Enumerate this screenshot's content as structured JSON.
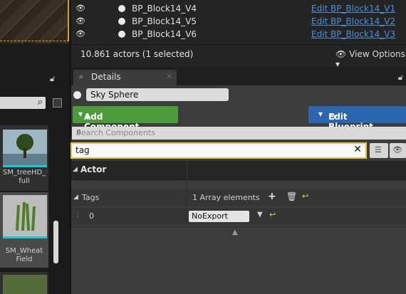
{
  "outliner": {
    "rows": [
      {
        "name": "BP_Block14_V4",
        "link": "Edit BP_Block14_V1"
      },
      {
        "name": "BP_Block14_V5",
        "link": "Edit BP_Block14_V2"
      },
      {
        "name": "BP_Block14_V6",
        "link": "Edit BP_Block14_V3"
      }
    ],
    "status": "10.861 actors (1 selected)",
    "view_options": "View Options"
  },
  "content_browser": {
    "assets": [
      {
        "label": "SM_treeHD_\nfull"
      },
      {
        "label": "SM_Wheat\nField"
      }
    ]
  },
  "details": {
    "tab_label": "Details",
    "actor_name": "Sky Sphere",
    "add_component": "Add Component",
    "edit_blueprint": "Edit Blueprint",
    "search_components_placeholder": "Search Components",
    "filter_value": "tag",
    "category": "Actor",
    "tags_label": "Tags",
    "tags_value": "1 Array elements",
    "element_index": "0",
    "element_value": "NoExport"
  },
  "icons": [
    "eye-icon",
    "lock-icon",
    "search-icon",
    "plus-icon",
    "trash-icon",
    "reset-arrow-icon",
    "gear-icon",
    "grid-icon",
    "close-icon"
  ],
  "colors": {
    "add_component": "#4e9b3c",
    "edit_blueprint": "#2b66b0",
    "filter_border": "#f2c12e",
    "link": "#4d8fd6"
  }
}
